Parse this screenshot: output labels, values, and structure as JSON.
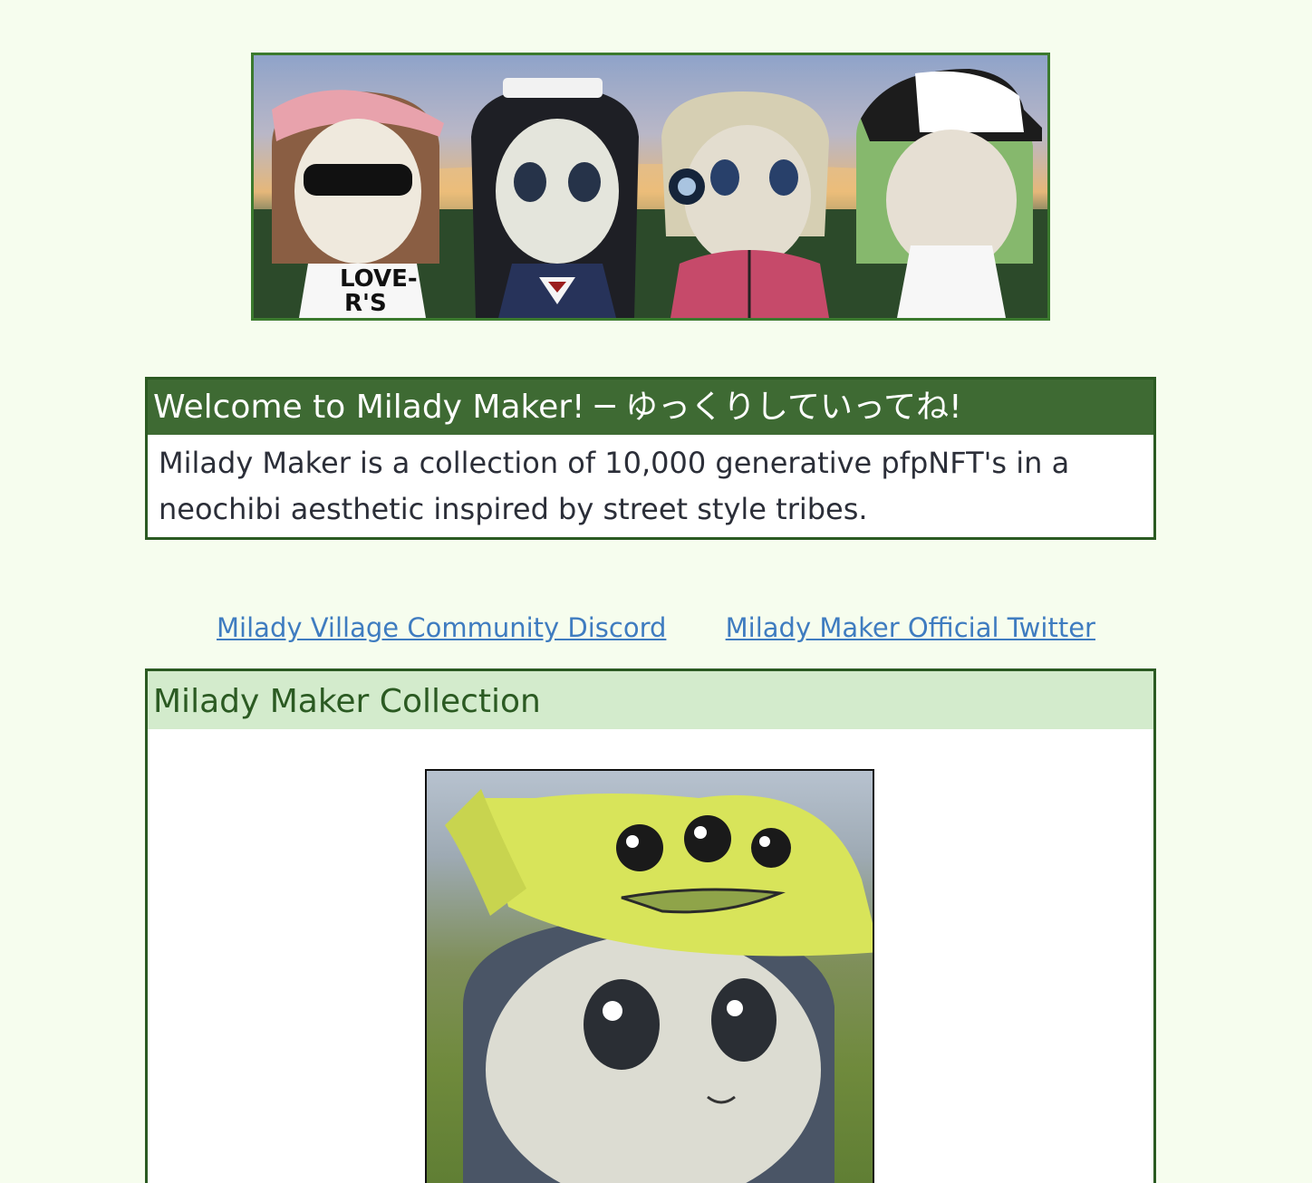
{
  "banner": {
    "image_description_icon": "milady-banner-image"
  },
  "welcome": {
    "title": "Welcome to Milady Maker! ─ ゆっくりしていってね!",
    "body": "Milady Maker is a collection of 10,000 generative pfpNFT's in a neochibi aesthetic inspired by street style tribes."
  },
  "links": [
    {
      "label": "Milady Village Community Discord"
    },
    {
      "label": "Milady Maker Official Twitter"
    }
  ],
  "collection": {
    "title": "Milady Maker Collection",
    "image_icon": "milady-nft-image"
  },
  "colors": {
    "page_bg": "#f6fdee",
    "accent_dark_green": "#3e6a33",
    "light_green": "#d3ebcc",
    "link_blue": "#3f7cc0"
  }
}
